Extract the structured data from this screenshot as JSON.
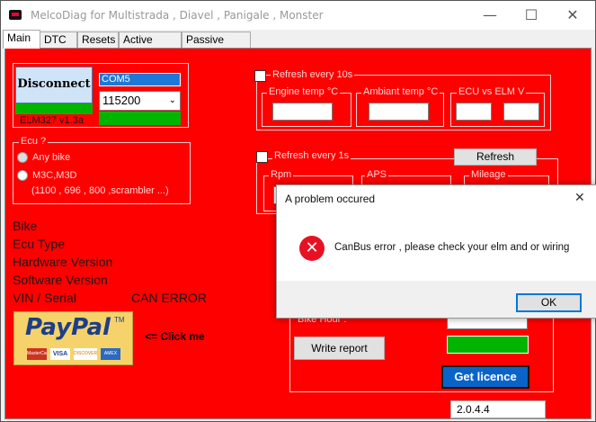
{
  "window": {
    "title": "MelcoDiag for Multistrada , Diavel , Panigale , Monster",
    "minimize": "—",
    "maximize": "☐",
    "close": "✕"
  },
  "tabs": [
    "Main",
    "DTC",
    "Resets",
    "Active Tests",
    "Passive Tests"
  ],
  "connection": {
    "disconnect_label": "Disconnect",
    "com_port": "COM5",
    "baud_rate": "115200",
    "elm_version": "ELM327 v1.3a"
  },
  "ecu_group": {
    "label": "Ecu ?",
    "option1": "Any bike",
    "option2": "M3C,M3D",
    "option2_sub": "(1100 , 696 , 800 ,scrambler ...)"
  },
  "info": {
    "bike": "Bike",
    "ecu_type": "Ecu Type",
    "hardware": "Hardware Version",
    "software": "Software Version",
    "vin": "VIN / Serial",
    "can_error": "CAN ERROR"
  },
  "paypal": {
    "logo": "PayPal",
    "tm": "TM",
    "cards": [
      "MasterCard",
      "VISA",
      "DISCOVER",
      "AMEX"
    ],
    "click_me": "<= Click me"
  },
  "refresh10": {
    "label": "Refresh every 10s",
    "engine_temp": "Engine temp °C",
    "ambiant_temp": "Ambiant temp °C",
    "ecu_vs_elm": "ECU vs ELM V"
  },
  "refresh1": {
    "label": "Refresh every 1s",
    "rpm": "Rpm",
    "aps": "APS",
    "mileage": "Mileage",
    "refresh_button": "Refresh"
  },
  "lower": {
    "bike_hour": "Bike Hour :",
    "write_report": "Write report",
    "get_licence": "Get licence"
  },
  "version": "2.0.4.4",
  "dialog": {
    "title": "A problem occured",
    "message": "CanBus error , please check your elm and or wiring",
    "ok": "OK",
    "close": "✕"
  },
  "colors": {
    "main_bg": "#ff0000",
    "status_green": "#00b400",
    "licence_blue": "#0a64c8"
  }
}
